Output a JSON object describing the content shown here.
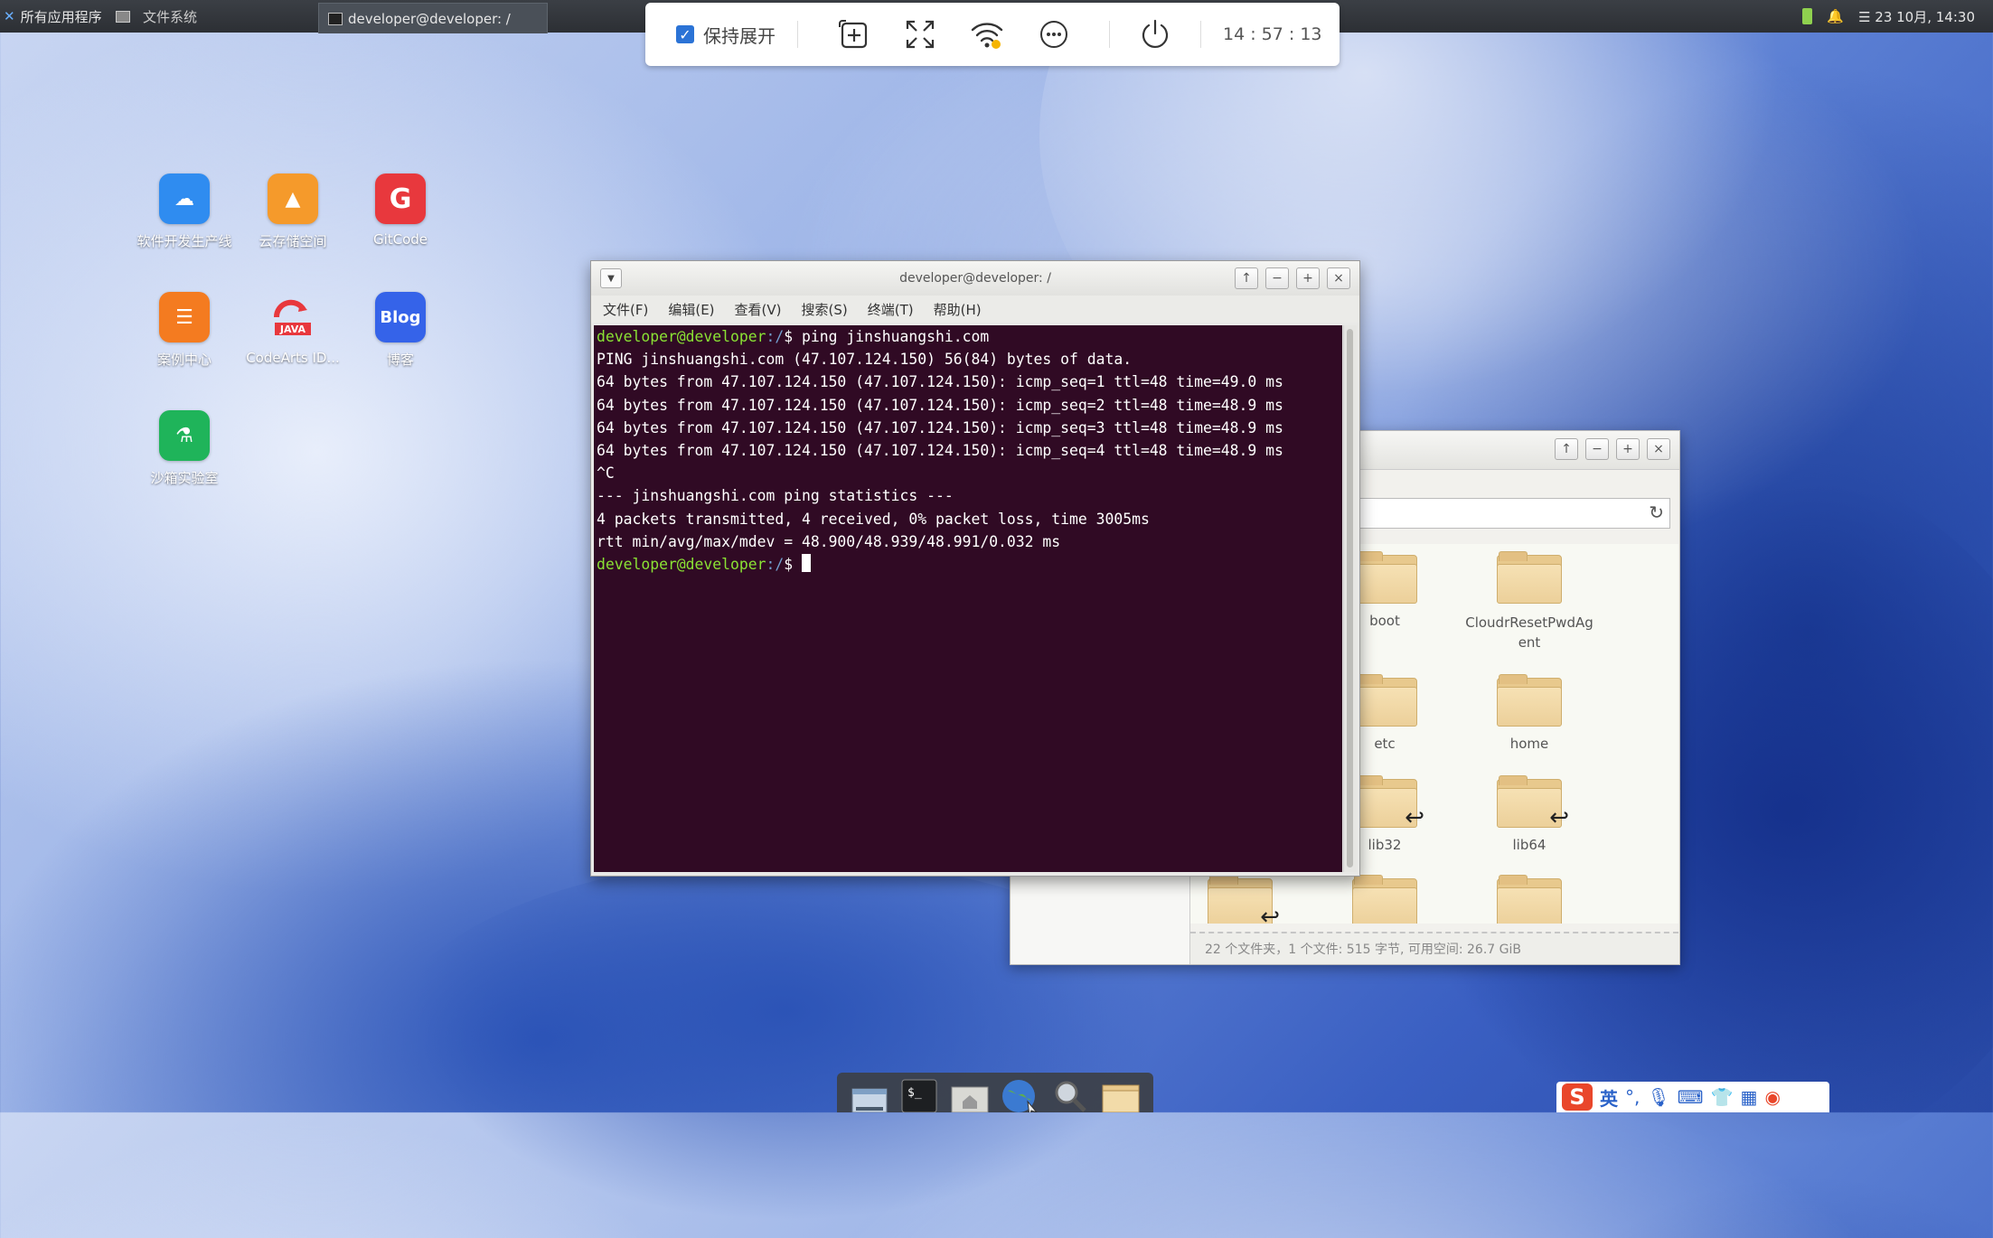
{
  "top_panel": {
    "apps_menu": "所有应用程序",
    "task_filemanager": "文件系统",
    "task_terminal": "developer@developer: /",
    "datetime": "23 10月, 14:30"
  },
  "float_toolbar": {
    "keep_expanded": "保持展开",
    "clock": "14 : 57 : 13"
  },
  "desktop_icons": [
    {
      "label": "软件开发生产线",
      "color": "#2f8cf0"
    },
    {
      "label": "云存储空间",
      "color": "#f59a2b"
    },
    {
      "label": "GitCode",
      "color": "#e8383d"
    },
    {
      "label": "案例中心",
      "color": "#f47b20"
    },
    {
      "label": "CodeArts ID...",
      "color": "#e8383d"
    },
    {
      "label": "博客",
      "color": "#3563e9"
    },
    {
      "label": "沙箱实验室",
      "color": "#1fb45a"
    }
  ],
  "terminal": {
    "title": "developer@developer: /",
    "menu": [
      "文件(F)",
      "编辑(E)",
      "查看(V)",
      "搜索(S)",
      "终端(T)",
      "帮助(H)"
    ],
    "prompt_user": "developer@developer",
    "prompt_path": ":/",
    "prompt_symbol": "$ ",
    "command": "ping jinshuangshi.com",
    "output": [
      "PING jinshuangshi.com (47.107.124.150) 56(84) bytes of data.",
      "64 bytes from 47.107.124.150 (47.107.124.150): icmp_seq=1 ttl=48 time=49.0 ms",
      "64 bytes from 47.107.124.150 (47.107.124.150): icmp_seq=2 ttl=48 time=48.9 ms",
      "64 bytes from 47.107.124.150 (47.107.124.150): icmp_seq=3 ttl=48 time=48.9 ms",
      "64 bytes from 47.107.124.150 (47.107.124.150): icmp_seq=4 ttl=48 time=48.9 ms",
      "^C",
      "--- jinshuangshi.com ping statistics ---",
      "4 packets transmitted, 4 received, 0% packet loss, time 3005ms",
      "rtt min/avg/max/mdev = 48.900/48.939/48.991/0.032 ms"
    ]
  },
  "file_manager": {
    "folders": [
      {
        "name": "boot",
        "link": false
      },
      {
        "name": "CloudrResetPwdAgent",
        "link": false
      },
      {
        "name": "etc",
        "link": false
      },
      {
        "name": "home",
        "link": false
      },
      {
        "name": "lib32",
        "link": true
      },
      {
        "name": "lib64",
        "link": true
      }
    ],
    "status": "22 个文件夹，1 个文件: 515 字节, 可用空间: 26.7 GiB"
  },
  "ime": {
    "lang": "英"
  }
}
